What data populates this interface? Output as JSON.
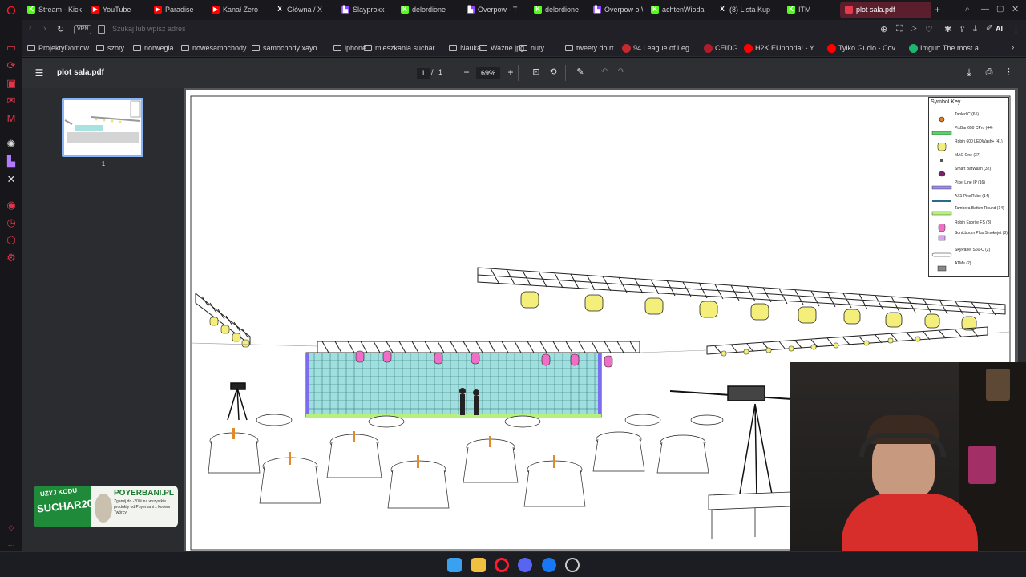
{
  "browser": {
    "tabs": [
      {
        "label": "Stream - Kick",
        "icon": "kick-icon",
        "color": "#53fc18"
      },
      {
        "label": "YouTube",
        "icon": "youtube-icon",
        "color": "#ff0000"
      },
      {
        "label": "Paradise",
        "icon": "youtube-icon",
        "color": "#ff0000"
      },
      {
        "label": "Kanał Zero",
        "icon": "youtube-icon",
        "color": "#ff0000"
      },
      {
        "label": "Główna / X",
        "icon": "x-icon",
        "color": "#ffffff"
      },
      {
        "label": "Slayproxx",
        "icon": "twitch-icon",
        "color": "#9146ff"
      },
      {
        "label": "delordione",
        "icon": "kick-icon",
        "color": "#53fc18"
      },
      {
        "label": "Overpow - T",
        "icon": "twitch-icon",
        "color": "#9146ff"
      },
      {
        "label": "delordione",
        "icon": "kick-icon",
        "color": "#53fc18"
      },
      {
        "label": "Overpow o W",
        "icon": "twitch-icon",
        "color": "#9146ff"
      },
      {
        "label": "achtenWioda",
        "icon": "kick-icon",
        "color": "#53fc18"
      },
      {
        "label": "(8) Lista Kup",
        "icon": "x-icon",
        "color": "#ffffff"
      },
      {
        "label": "ITM",
        "icon": "kick-icon",
        "color": "#53fc18"
      },
      {
        "label": "plot sala.pdf",
        "icon": "pdf-icon",
        "color": "#e8394a",
        "active": true
      }
    ],
    "address_placeholder": "Szukaj lub wpisz adres",
    "vpn_label": "VPN",
    "ai_label": "AI",
    "bookmarks": [
      {
        "label": "ProjektyDomow",
        "type": "folder"
      },
      {
        "label": "szoty",
        "type": "folder"
      },
      {
        "label": "norwegia",
        "type": "folder"
      },
      {
        "label": "nowesamochody",
        "type": "folder"
      },
      {
        "label": "samochody xayo",
        "type": "folder"
      },
      {
        "label": "iphone",
        "type": "folder"
      },
      {
        "label": "mieszkania suchar",
        "type": "folder"
      },
      {
        "label": "Nauka",
        "type": "folder"
      },
      {
        "label": "Ważne jpg",
        "type": "folder"
      },
      {
        "label": "nuty",
        "type": "folder"
      },
      {
        "label": "tweety do rt",
        "type": "folder"
      },
      {
        "label": "94 League of Leg...",
        "type": "site",
        "color": "#c8282d"
      },
      {
        "label": "CEIDG",
        "type": "site",
        "color": "#b11b2a"
      },
      {
        "label": "H2K EUphoria! - Y...",
        "type": "site",
        "color": "#ff0000"
      },
      {
        "label": "Tylko Gucio - Cov...",
        "type": "site",
        "color": "#ff0000"
      },
      {
        "label": "Imgur: The most a...",
        "type": "site",
        "color": "#1bb76e"
      }
    ]
  },
  "pdf": {
    "title": "plot sala.pdf",
    "page_current": "1",
    "page_sep": "/",
    "page_total": "1",
    "zoom": "69%",
    "thumb_label": "1",
    "legend": {
      "title": "Symbol Key",
      "items": [
        {
          "label": "Tabled C (65)",
          "sym": "dot-orange"
        },
        {
          "label": "PixBar 650 CPro (44)",
          "sym": "bar-green"
        },
        {
          "label": "Robin 600 LEDWash+ (41)",
          "sym": "wash-yellow"
        },
        {
          "label": "MAC One (37)",
          "sym": "small-dark"
        },
        {
          "label": "Smart BatWash (32)",
          "sym": "oval-purple"
        },
        {
          "label": "Pixel Line IP (16)",
          "sym": "bar-blue"
        },
        {
          "label": "AX1 PixelTube (14)",
          "sym": "line-teal"
        },
        {
          "label": "Tambora Batten Round (14)",
          "sym": "bar-lime"
        },
        {
          "label": "Robin Esprite FS (8)",
          "sym": "spot-pink"
        },
        {
          "label": "Sonicboom Plus Smokejet (8)",
          "sym": "box-violet"
        },
        {
          "label": "SkyPanel S60-C (2)",
          "sym": "panel-white"
        },
        {
          "label": "ATMe (2)",
          "sym": "box-grey"
        }
      ]
    }
  },
  "promo": {
    "code_top": "UŻYJ KODU",
    "code": "SUCHAR20",
    "brand": "POYERBANI.PL",
    "text": "Zgarnij do -20% na wszystkie produkty od Poyerbani z kodem Twórcy"
  },
  "colors": {
    "accent": "#e0364a",
    "toolbar": "#2d2f33",
    "led_wall": "#9fe0df",
    "fixture_yellow": "#f4ef7a",
    "fixture_pink": "#f06ec8"
  }
}
